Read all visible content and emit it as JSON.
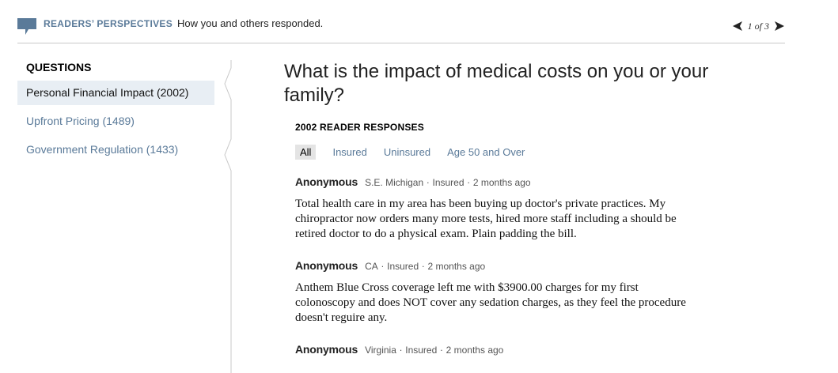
{
  "header": {
    "brand_label": "READERS’ PERSPECTIVES",
    "subtitle": "How you and others responded.",
    "pager_text": "1 of 3"
  },
  "questions": {
    "heading": "QUESTIONS",
    "items": [
      {
        "label": "Personal Financial Impact (2002)",
        "active": true
      },
      {
        "label": "Upfront Pricing (1489)",
        "active": false
      },
      {
        "label": "Government Regulation (1433)",
        "active": false
      }
    ]
  },
  "main": {
    "question_title": "What is the impact of medical costs on you or your family?",
    "responses_count": "2002 READER RESPONSES",
    "filters": [
      "All",
      "Insured",
      "Uninsured",
      "Age 50 and Over"
    ],
    "responses": [
      {
        "author": "Anonymous",
        "location": "S.E. Michigan",
        "status": "Insured",
        "time": "2 months ago",
        "body": "Total health care in my area has been buying up doctor's private practices. My chiropractor now orders many more tests, hired more staff including a should be retired doctor to do a physical exam. Plain padding the bill."
      },
      {
        "author": "Anonymous",
        "location": "CA",
        "status": "Insured",
        "time": "2 months ago",
        "body": "Anthem Blue Cross coverage left me with $3900.00 charges for my first colonoscopy and does NOT cover any sedation charges, as they feel the procedure doesn't reguire any."
      },
      {
        "author": "Anonymous",
        "location": "Virginia",
        "status": "Insured",
        "time": "2 months ago",
        "body": ""
      }
    ]
  },
  "colors": {
    "accent": "#5a7a99",
    "active_bg": "#e8eef4",
    "filter_active_bg": "#e4e4e4",
    "divider": "#c8c8c8"
  },
  "icons": {
    "brand": "speech-bubble-icon",
    "prev": "triangle-left-icon",
    "next": "triangle-right-icon"
  }
}
